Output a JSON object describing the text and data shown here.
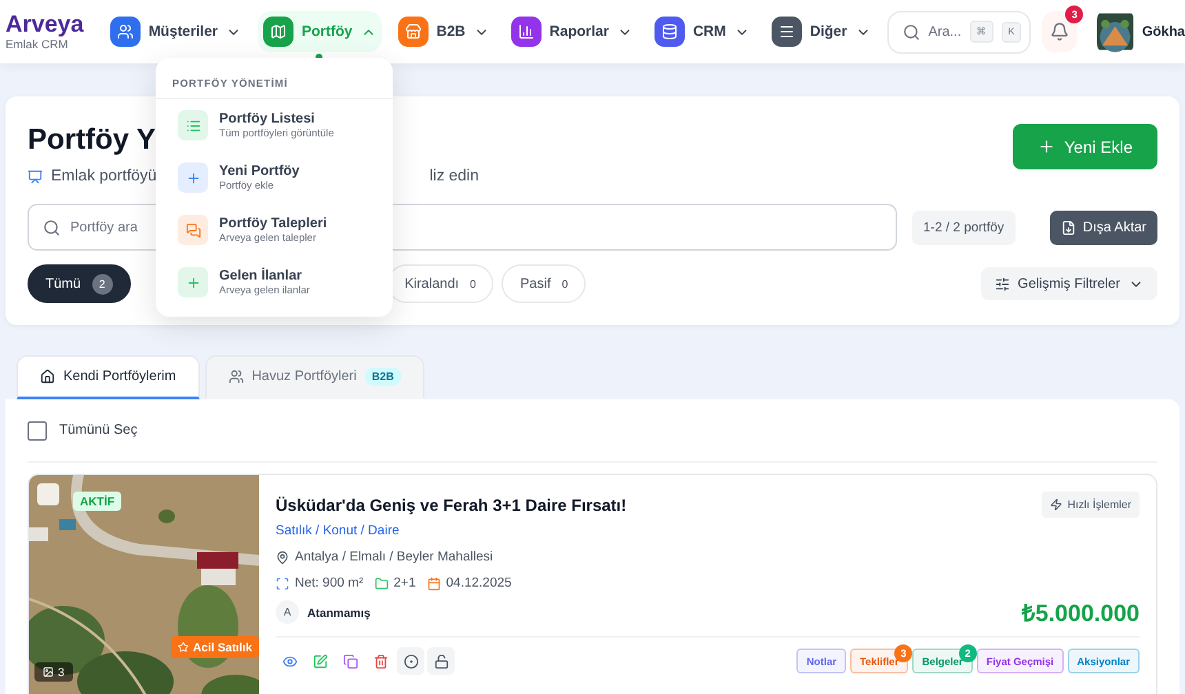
{
  "brand": {
    "name": "Arveya",
    "tagline": "Emlak CRM"
  },
  "nav": [
    {
      "label": "Müşteriler",
      "color": "#2f6fed",
      "selected": false
    },
    {
      "label": "Portföy",
      "color": "#16a34a",
      "selected": true
    },
    {
      "label": "B2B",
      "color": "#f97316",
      "selected": false
    },
    {
      "label": "Raporlar",
      "color": "#9333ea",
      "selected": false
    },
    {
      "label": "CRM",
      "color": "#4f5bef",
      "selected": false
    },
    {
      "label": "Diğer",
      "color": "#4b5563",
      "selected": false
    }
  ],
  "search": {
    "placeholder": "Ara...",
    "keys": [
      "⌘",
      "K"
    ]
  },
  "notifications": {
    "count": "3"
  },
  "user": {
    "name": "Gökha"
  },
  "dropdown": {
    "heading": "PORTFÖY YÖNETİMİ",
    "items": [
      {
        "title": "Portföy Listesi",
        "subtitle": "Tüm portföyleri görüntüle",
        "color": "#22c55e"
      },
      {
        "title": "Yeni Portföy",
        "subtitle": "Portföy ekle",
        "color": "#3b82f6"
      },
      {
        "title": "Portföy Talepleri",
        "subtitle": "Arveya gelen talepler",
        "color": "#f97316"
      },
      {
        "title": "Gelen İlanlar",
        "subtitle": "Arveya gelen ilanlar",
        "color": "#22c55e"
      }
    ]
  },
  "page": {
    "title": "Portföy Y",
    "subtitle_parts": [
      "Emlak portföyü",
      "liz edin"
    ],
    "add_button": "Yeni Ekle",
    "search_placeholder": "Portföy ara",
    "count": "1-2 / 2 portföy",
    "export_button": "Dışa Aktar",
    "advanced_filters": "Gelişmiş Filtreler"
  },
  "filters": [
    {
      "label": "Tümü",
      "count": "2",
      "selected": true
    },
    {
      "label": "Kiralandı",
      "count": "0",
      "selected": false
    },
    {
      "label": "Pasif",
      "count": "0",
      "selected": false
    }
  ],
  "tabs": [
    {
      "label": "Kendi Portföylerim",
      "selected": true
    },
    {
      "label": "Havuz Portföyleri",
      "badge": "B2B",
      "selected": false
    }
  ],
  "select_all": {
    "label": "Tümünü Seç",
    "checked": false
  },
  "listing": {
    "checked": false,
    "status": "AKTİF",
    "urgent": "Acil Satılık",
    "photo_count": "3",
    "title": "Üsküdar'da Geniş ve Ferah 3+1 Daire Fırsatı!",
    "category": "Satılık / Konut / Daire",
    "location": "Antalya / Elmalı / Beyler Mahallesi",
    "area": "Net: 900 m²",
    "rooms": "2+1",
    "date": "04.12.2025",
    "agent_initial": "A",
    "agent": "Atanmamış",
    "quick_actions": "Hızlı İşlemler",
    "price": "₺5.000.000",
    "tags": [
      {
        "label": "Notlar",
        "color": "#6366f1"
      },
      {
        "label": "Teklifler",
        "color": "#ea580c",
        "badge": "3"
      },
      {
        "label": "Belgeler",
        "color": "#059669",
        "badge": "2"
      },
      {
        "label": "Fiyat Geçmişi",
        "color": "#9333ea"
      },
      {
        "label": "Aksiyonlar",
        "color": "#0284c7"
      }
    ]
  }
}
